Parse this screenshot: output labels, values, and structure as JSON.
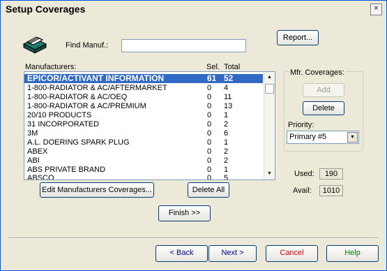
{
  "window": {
    "title": "Setup Coverages",
    "close_label": "×"
  },
  "find": {
    "label": "Find Manuf.:",
    "value": ""
  },
  "report_label": "Report...",
  "list": {
    "headers": {
      "name": "Manufacturers:",
      "sel": "Sel.",
      "total": "Total"
    },
    "items": [
      {
        "name": "EPICOR/ACTIVANT INFORMATION",
        "sel": "61",
        "total": "52"
      },
      {
        "name": "1-800-RADIATOR & AC/AFTERMARKET",
        "sel": "0",
        "total": "4"
      },
      {
        "name": "1-800-RADIATOR & AC/OEQ",
        "sel": "0",
        "total": "11"
      },
      {
        "name": "1-800-RADIATOR & AC/PREMIUM",
        "sel": "0",
        "total": "13"
      },
      {
        "name": "20/10 PRODUCTS",
        "sel": "0",
        "total": "1"
      },
      {
        "name": "31 INCORPORATED",
        "sel": "0",
        "total": "2"
      },
      {
        "name": "3M",
        "sel": "0",
        "total": "6"
      },
      {
        "name": "A.L. DOERING SPARK PLUG",
        "sel": "0",
        "total": "1"
      },
      {
        "name": "ABEX",
        "sel": "0",
        "total": "2"
      },
      {
        "name": "ABI",
        "sel": "0",
        "total": "2"
      },
      {
        "name": "ABS PRIVATE BRAND",
        "sel": "0",
        "total": "1"
      },
      {
        "name": "ABSCO",
        "sel": "0",
        "total": "5"
      }
    ]
  },
  "mfr_group": {
    "label": "Mfr. Coverages:",
    "add_label": "Add",
    "delete_label": "Delete"
  },
  "priority": {
    "label": "Priority:",
    "value": "Primary #5"
  },
  "counts": {
    "used_label": "Used:",
    "used_value": "190",
    "avail_label": "Avail:",
    "avail_value": "1010"
  },
  "buttons": {
    "edit_label": "Edit Manufacturers Coverages...",
    "delete_all_label": "Delete All",
    "finish_label": "Finish >>",
    "back_label": "< Back",
    "next_label": "Next >",
    "cancel_label": "Cancel",
    "help_label": "Help"
  },
  "colors": {
    "selection": "#316ac5",
    "cancel_text": "#c00000",
    "help_text": "#008000",
    "next_text": "#000080",
    "back_text": "#000080"
  },
  "icons": {
    "app": "card-file-icon",
    "scroll_up": "scroll-up-arrow-icon",
    "scroll_down": "scroll-down-arrow-icon",
    "dropdown": "dropdown-arrow-icon"
  }
}
